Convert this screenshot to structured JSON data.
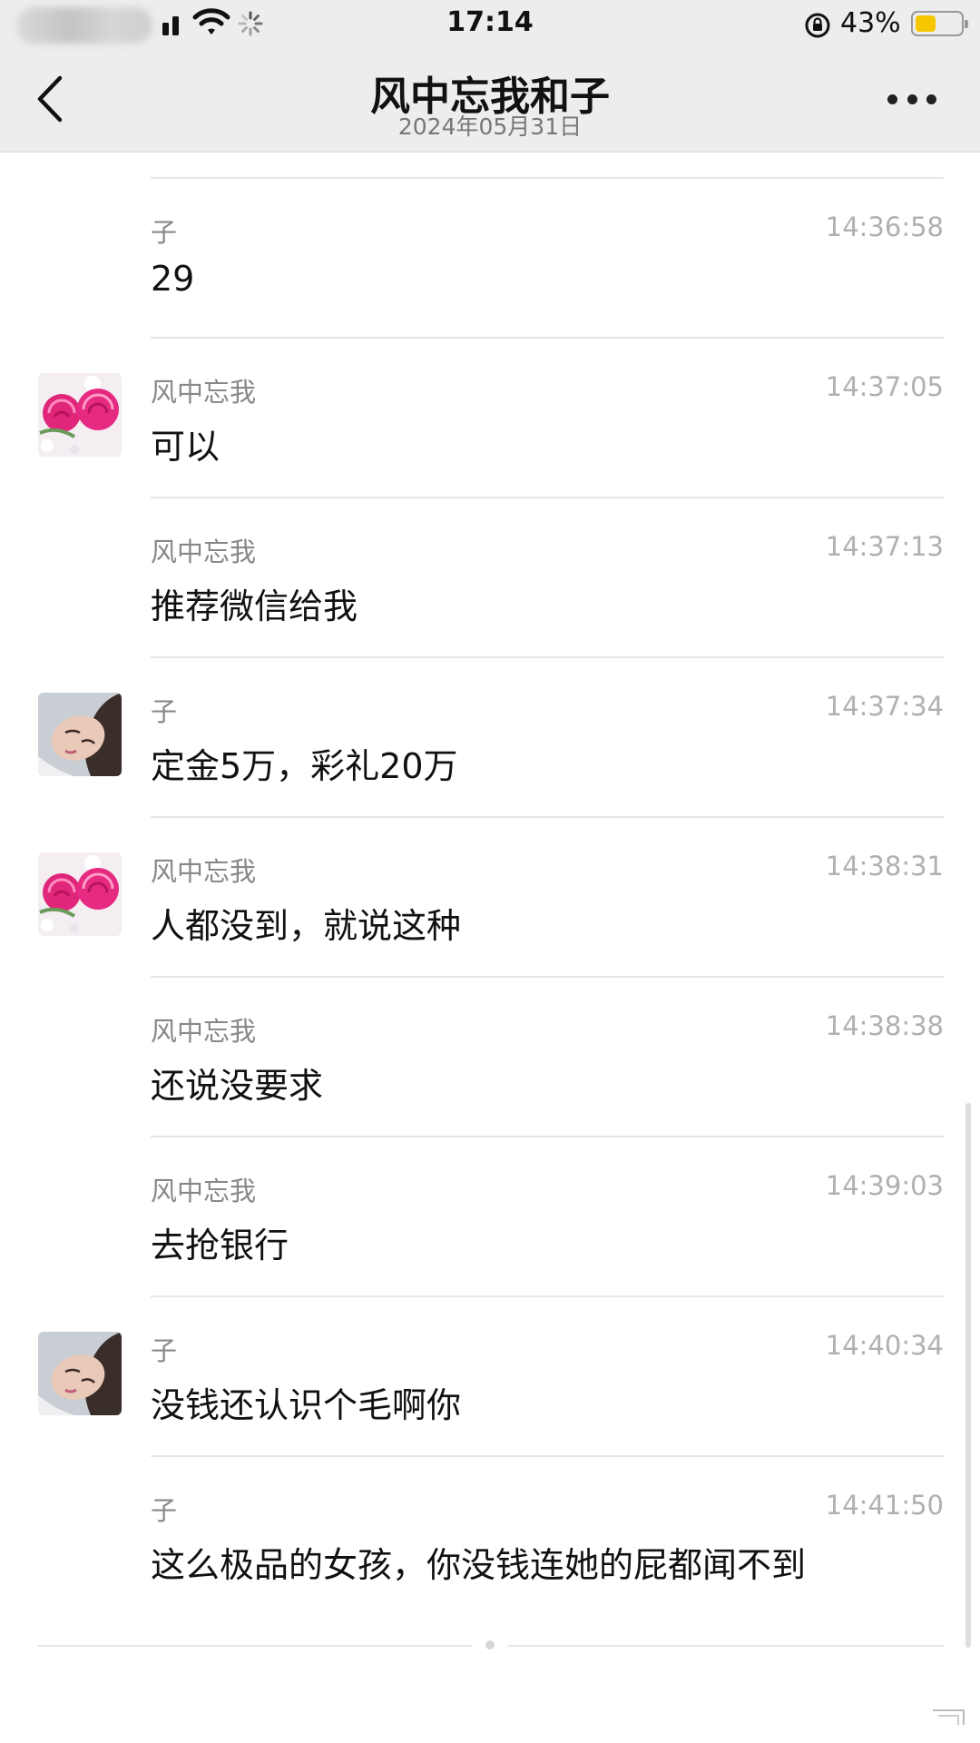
{
  "status_bar": {
    "time": "17:14",
    "battery_percent": "43%",
    "battery_level": 0.43,
    "battery_color": "#f6c700"
  },
  "nav": {
    "title": "风中忘我和子",
    "subtitle": "2024年05月31日",
    "icons": {
      "back": "chevron-left-icon",
      "more": "more-dots-icon"
    }
  },
  "messages": [
    {
      "sender": "子",
      "time": "14:36:58",
      "text": "29",
      "avatar": "none"
    },
    {
      "sender": "风中忘我",
      "time": "14:37:05",
      "text": "可以",
      "avatar": "roses"
    },
    {
      "sender": "风中忘我",
      "time": "14:37:13",
      "text": "推荐微信给我",
      "avatar": "none"
    },
    {
      "sender": "子",
      "time": "14:37:34",
      "text": "定金5万，彩礼20万",
      "avatar": "portrait"
    },
    {
      "sender": "风中忘我",
      "time": "14:38:31",
      "text": "人都没到，就说这种",
      "avatar": "roses"
    },
    {
      "sender": "风中忘我",
      "time": "14:38:38",
      "text": "还说没要求",
      "avatar": "none"
    },
    {
      "sender": "风中忘我",
      "time": "14:39:03",
      "text": "去抢银行",
      "avatar": "none"
    },
    {
      "sender": "子",
      "time": "14:40:34",
      "text": "没钱还认识个毛啊你",
      "avatar": "portrait"
    },
    {
      "sender": "子",
      "time": "14:41:50",
      "text": "这么极品的女孩，你没钱连她的屁都闻不到",
      "avatar": "none"
    }
  ]
}
